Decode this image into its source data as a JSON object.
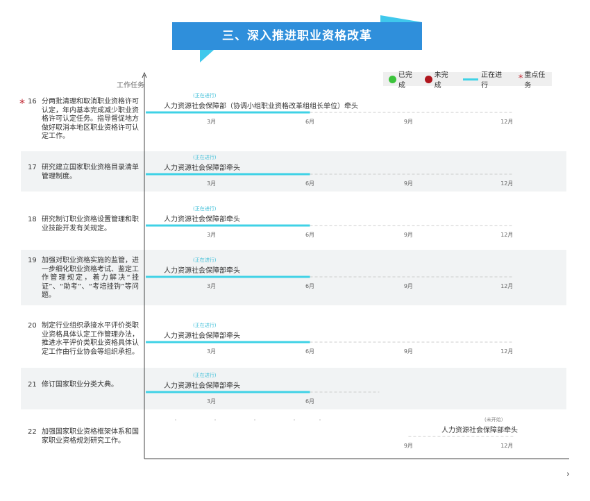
{
  "banner": {
    "title": "三、深入推进职业资格改革"
  },
  "legend": {
    "items": [
      {
        "label": "已完成",
        "color": "#3cc43c",
        "icon": "green-dot"
      },
      {
        "label": "未完成",
        "color": "#b0161e",
        "icon": "red-dot"
      },
      {
        "label": "正在进行",
        "color": "#3fd2e6",
        "icon": "cyan-line"
      },
      {
        "label": "重点任务",
        "color": "#c0242f",
        "icon": "red-star"
      }
    ]
  },
  "chart_data": {
    "type": "gantt",
    "ylabel": "工作任务",
    "months": [
      "3月",
      "6月",
      "9月",
      "12月"
    ],
    "tasks": [
      {
        "id": "16",
        "key": true,
        "text": "分两批清理和取消职业资格许可认定，年内基本完成减少职业资格许可认定任务。指导督促地方做好取消本地区职业资格许可认定工作。",
        "lead": "人力资源社会保障部（协调小组职业资格改革组组长单位）牵头",
        "status": "(正在进行)",
        "progress_month": 6
      },
      {
        "id": "17",
        "key": false,
        "text": "研究建立国家职业资格目录清单管理制度。",
        "lead": "人力资源社会保障部牵头",
        "status": "(正在进行)",
        "progress_month": 6
      },
      {
        "id": "18",
        "key": false,
        "text": "研究制订职业资格设置管理和职业技能开发有关规定。",
        "lead": "人力资源社会保障部牵头",
        "status": "(正在进行)",
        "progress_month": 6
      },
      {
        "id": "19",
        "key": false,
        "text": "加强对职业资格实施的监管，进一步细化职业资格考试、鉴定工作管理规定，着力解决“挂证”、“助考”、“考培挂钩”等问题。",
        "lead": "人力资源社会保障部牵头",
        "status": "(正在进行)",
        "progress_month": 6
      },
      {
        "id": "20",
        "key": false,
        "text": "制定行业组织承接水平评价类职业资格具体认定工作管理办法，推进水平评价类职业资格具体认定工作由行业协会等组织承担。",
        "lead": "人力资源社会保障部牵头",
        "status": "(正在进行)",
        "progress_month": 6
      },
      {
        "id": "21",
        "key": false,
        "text": "修订国家职业分类大典。",
        "lead": "人力资源社会保障部牵头",
        "status": "(正在进行)",
        "progress_month": 6
      },
      {
        "id": "22",
        "key": false,
        "text": "加强国家职业资格框架体系和国家职业资格规划研究工作。",
        "lead": "人力资源社会保障部牵头",
        "status": "(未开始)",
        "progress_month": null
      }
    ]
  },
  "nav": {
    "next_label": "›"
  }
}
